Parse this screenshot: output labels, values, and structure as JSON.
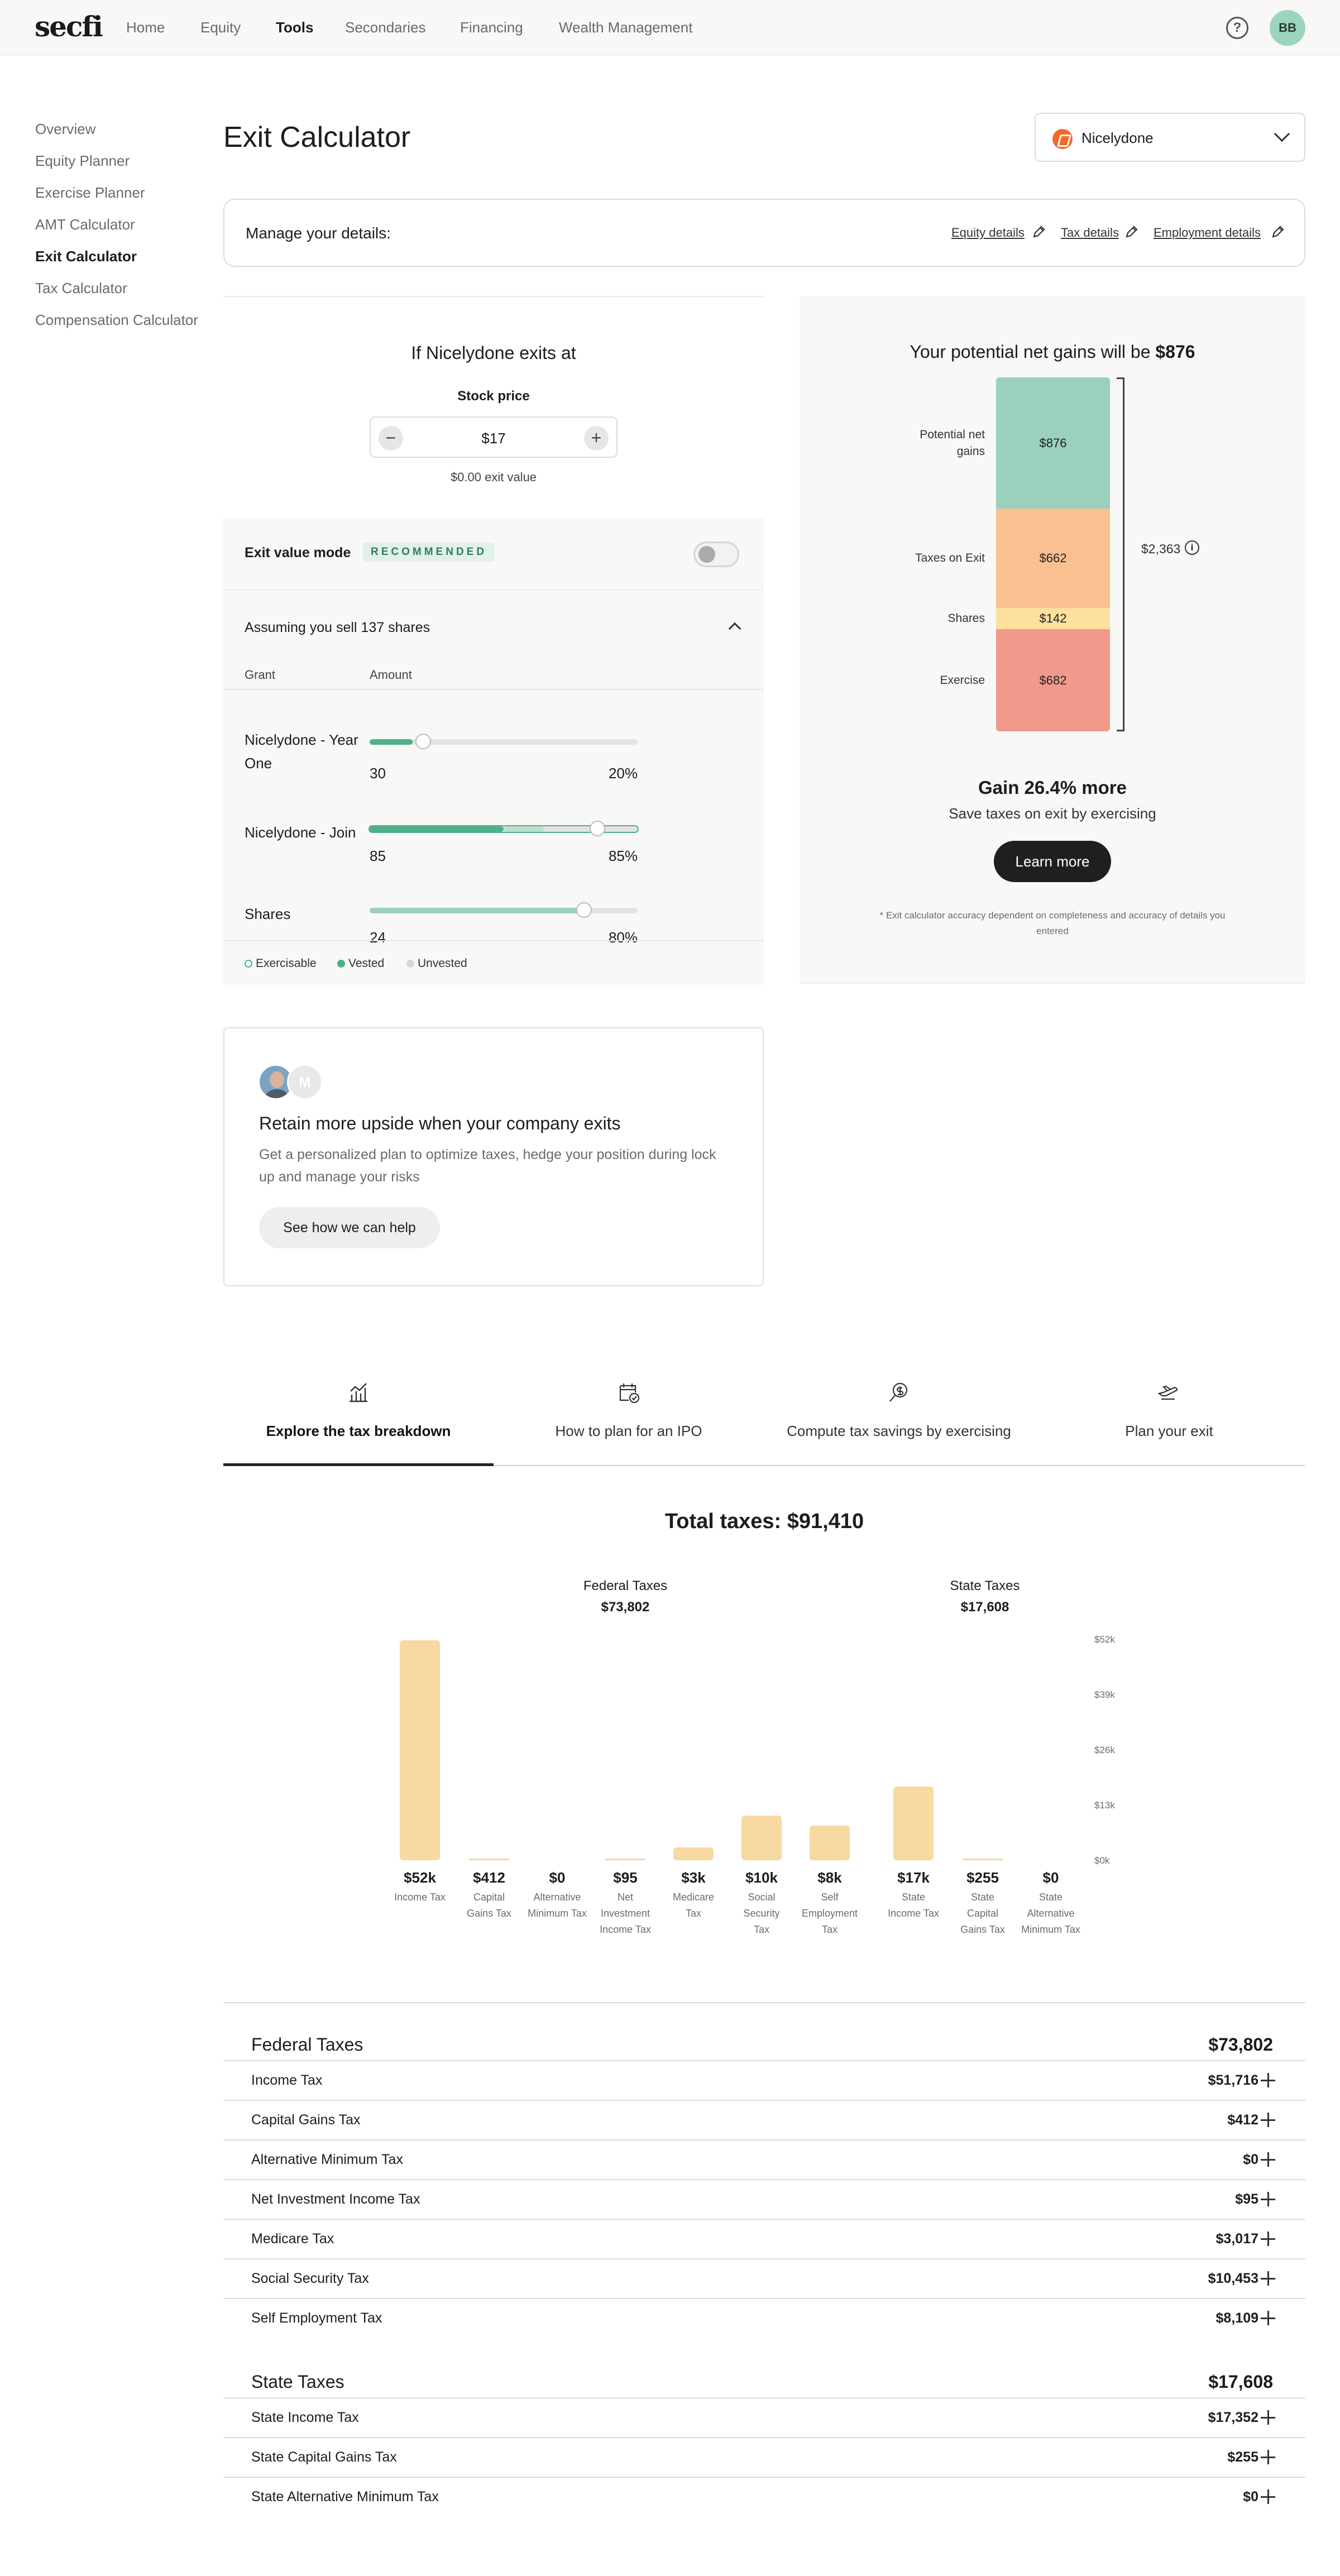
{
  "header": {
    "logo": "secfi",
    "nav": [
      "Home",
      "Equity",
      "Tools",
      "Secondaries",
      "Financing",
      "Wealth Management"
    ],
    "active_nav": "Tools",
    "help_icon": "?",
    "avatar_initials": "BB"
  },
  "sidebar": {
    "items": [
      "Overview",
      "Equity Planner",
      "Exercise Planner",
      "AMT Calculator",
      "Exit Calculator",
      "Tax Calculator",
      "Compensation Calculator"
    ],
    "active": "Exit Calculator"
  },
  "page": {
    "title": "Exit Calculator",
    "company": "Nicelydone"
  },
  "manage": {
    "label": "Manage your details:",
    "links": [
      "Equity details",
      "Tax details",
      "Employment details"
    ]
  },
  "exit_panel": {
    "title": "If Nicelydone exits at",
    "stock_label": "Stock price",
    "minus": "−",
    "plus": "+",
    "stock_price": "$17",
    "exit_value": "$0.00 exit value",
    "mode_label": "Exit value mode",
    "mode_badge": "RECOMMENDED",
    "mode_enabled": false,
    "assume": "Assuming you sell 137 shares",
    "col_grant": "Grant",
    "col_amount": "Amount",
    "grants": [
      {
        "name": "Nicelydone - Year One",
        "amount": "30",
        "pct": "20%",
        "exercisable": 0,
        "vested": 0.16,
        "unvested": 0.84
      },
      {
        "name": "Nicelydone - Join",
        "amount": "85",
        "pct": "85%",
        "exercisable": 0.15,
        "vested": 0.5,
        "unvested": 0.35
      },
      {
        "name": "Shares",
        "amount": "24",
        "pct": "80%",
        "exercisable": 0,
        "vested": 0.8,
        "unvested": 0.2
      }
    ],
    "legend": [
      "Exercisable",
      "Vested",
      "Unvested"
    ]
  },
  "gains_panel": {
    "title_prefix": "Your potential net gains will be",
    "title_amount": "$876",
    "segments": [
      {
        "label": "Potential net gains",
        "value": "$876",
        "amount": 876,
        "color": "#9bd0bd"
      },
      {
        "label": "Taxes on Exit",
        "value": "$662",
        "amount": 662,
        "color": "#fbc08f"
      },
      {
        "label": "Shares",
        "value": "$142",
        "amount": 142,
        "color": "#fbe0a0"
      },
      {
        "label": "Exercise",
        "value": "$682",
        "amount": 682,
        "color": "#f19a8b"
      }
    ],
    "total": "$2,363",
    "info_icon": "i",
    "headline": "Gain 26.4% more",
    "sub": "Save taxes on exit by exercising",
    "button": "Learn more",
    "disclaimer": "* Exit calculator accuracy dependent on completeness and accuracy of details you entered"
  },
  "upsell": {
    "avatar2_initial": "M",
    "title": "Retain more upside when your company exits",
    "body": "Get a personalized plan to optimize taxes, hedge your position during lock up and manage your risks",
    "button": "See how we can help"
  },
  "tabs": [
    {
      "label": "Explore the tax breakdown",
      "icon": "chart-icon",
      "active": true
    },
    {
      "label": "How to plan for an IPO",
      "icon": "calendar-check-icon",
      "active": false
    },
    {
      "label": "Compute tax savings by exercising",
      "icon": "search-dollar-icon",
      "active": false
    },
    {
      "label": "Plan your exit",
      "icon": "plane-icon",
      "active": false
    }
  ],
  "breakdown": {
    "total": "Total taxes: $91,410",
    "federal_title": "Federal Taxes",
    "federal_total": "$73,802",
    "state_title": "State Taxes",
    "state_total": "$17,608"
  },
  "chart_data": {
    "type": "bar",
    "categories": [
      "Income Tax",
      "Capital Gains Tax",
      "Alternative Minimum Tax",
      "Net Investment Income Tax",
      "Medicare Tax",
      "Social Security Tax",
      "Self Employment Tax",
      "State Income Tax",
      "State Capital Gains Tax",
      "State Alternative Minimum Tax"
    ],
    "values": [
      51716,
      412,
      0,
      95,
      3017,
      10453,
      8109,
      17352,
      255,
      0
    ],
    "value_labels": [
      "$52k",
      "$412",
      "$0",
      "$95",
      "$3k",
      "$10k",
      "$8k",
      "$17k",
      "$255",
      "$0"
    ],
    "yticks": [
      "$0k",
      "$13k",
      "$26k",
      "$39k",
      "$52k"
    ],
    "ylim": [
      0,
      52000
    ],
    "bar_color": "#f8d9a1",
    "grid": false
  },
  "federal": {
    "title": "Federal Taxes",
    "total": "$73,802",
    "rows": [
      {
        "name": "Income Tax",
        "value": "$51,716"
      },
      {
        "name": "Capital Gains Tax",
        "value": "$412"
      },
      {
        "name": "Alternative Minimum Tax",
        "value": "$0"
      },
      {
        "name": "Net Investment Income Tax",
        "value": "$95"
      },
      {
        "name": "Medicare Tax",
        "value": "$3,017"
      },
      {
        "name": "Social Security Tax",
        "value": "$10,453"
      },
      {
        "name": "Self Employment Tax",
        "value": "$8,109"
      }
    ]
  },
  "state": {
    "title": "State Taxes",
    "total": "$17,608",
    "rows": [
      {
        "name": "State Income Tax",
        "value": "$17,352"
      },
      {
        "name": "State Capital Gains Tax",
        "value": "$255"
      },
      {
        "name": "State Alternative Minimum Tax",
        "value": "$0"
      }
    ]
  }
}
